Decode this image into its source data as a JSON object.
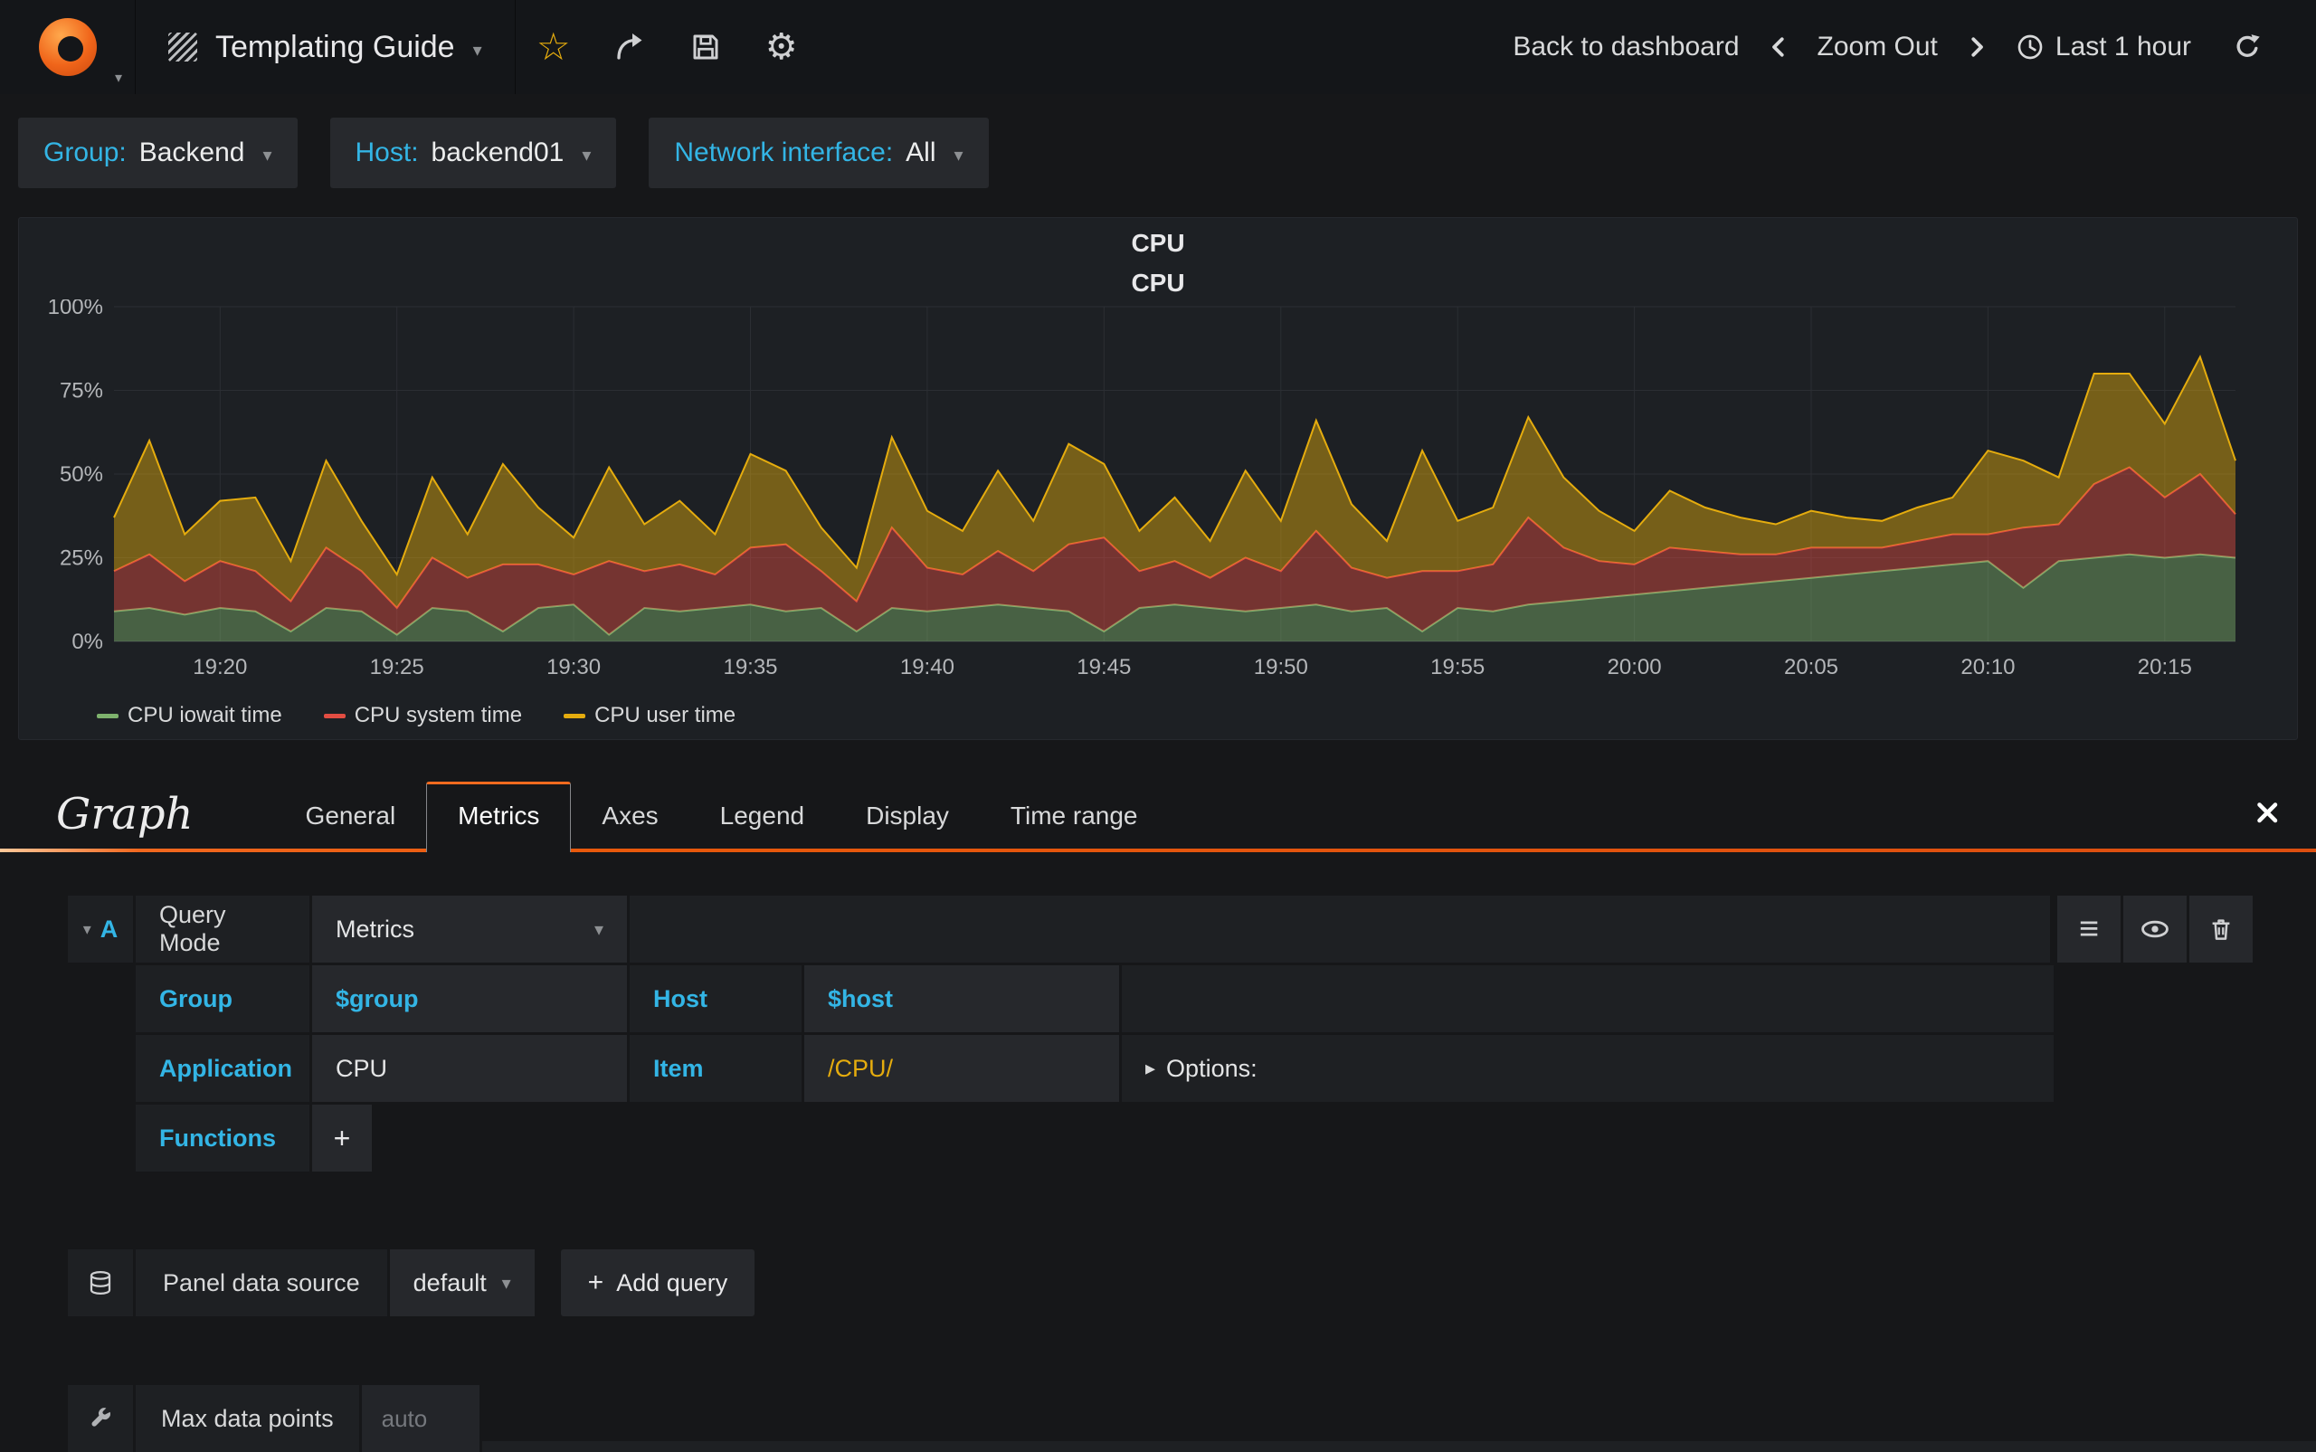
{
  "navbar": {
    "dashboard_title": "Templating Guide",
    "back_to_dashboard": "Back to dashboard",
    "zoom_out": "Zoom Out",
    "time_range": "Last 1 hour"
  },
  "icons": {
    "caret_down": "▾",
    "caret_right": "▸",
    "star": "☆",
    "gear": "⚙",
    "menu": "≡",
    "plus": "+"
  },
  "template_vars": [
    {
      "label": "Group:",
      "value": "Backend"
    },
    {
      "label": "Host:",
      "value": "backend01"
    },
    {
      "label": "Network interface:",
      "value": "All"
    }
  ],
  "panel": {
    "title": "CPU"
  },
  "chart_data": {
    "type": "area",
    "stacked": true,
    "title": "CPU",
    "xlabel": "",
    "ylabel": "",
    "ylim": [
      0,
      100
    ],
    "yticks": [
      "0%",
      "25%",
      "50%",
      "75%",
      "100%"
    ],
    "x_start": "19:17",
    "x_end": "20:17",
    "xticks": [
      "19:20",
      "19:25",
      "19:30",
      "19:35",
      "19:40",
      "19:45",
      "19:50",
      "19:55",
      "20:00",
      "20:05",
      "20:10",
      "20:15"
    ],
    "grid": true,
    "legend_position": "bottom",
    "series": [
      {
        "name": "CPU iowait time",
        "color": "#7eb26d",
        "values": [
          9,
          10,
          8,
          10,
          9,
          3,
          10,
          9,
          2,
          10,
          9,
          3,
          10,
          11,
          2,
          10,
          9,
          10,
          11,
          9,
          10,
          3,
          10,
          9,
          10,
          11,
          10,
          9,
          3,
          10,
          11,
          10,
          9,
          10,
          11,
          9,
          10,
          3,
          10,
          9,
          11,
          12,
          13,
          14,
          15,
          16,
          17,
          18,
          19,
          20,
          21,
          22,
          23,
          24,
          16,
          24,
          25,
          26,
          25,
          26,
          25
        ]
      },
      {
        "name": "CPU system time",
        "color": "#e24d42",
        "values": [
          12,
          16,
          10,
          14,
          12,
          9,
          18,
          12,
          8,
          15,
          10,
          20,
          13,
          9,
          22,
          11,
          14,
          10,
          17,
          20,
          11,
          9,
          24,
          13,
          10,
          16,
          11,
          20,
          28,
          11,
          13,
          9,
          16,
          11,
          22,
          13,
          9,
          18,
          11,
          14,
          26,
          16,
          11,
          9,
          13,
          11,
          9,
          8,
          9,
          8,
          7,
          8,
          9,
          8,
          18,
          11,
          22,
          26,
          18,
          24,
          13
        ]
      },
      {
        "name": "CPU user time",
        "color": "#e5ac0e",
        "values": [
          16,
          34,
          14,
          18,
          22,
          12,
          26,
          15,
          10,
          24,
          13,
          30,
          17,
          11,
          28,
          14,
          19,
          12,
          28,
          22,
          13,
          10,
          27,
          17,
          13,
          24,
          15,
          30,
          22,
          12,
          19,
          11,
          26,
          15,
          33,
          19,
          11,
          36,
          15,
          17,
          30,
          21,
          15,
          10,
          17,
          13,
          11,
          9,
          11,
          9,
          8,
          10,
          11,
          25,
          20,
          14,
          33,
          28,
          22,
          35,
          16
        ]
      }
    ]
  },
  "editor": {
    "panel_type": "Graph",
    "tabs": [
      "General",
      "Metrics",
      "Axes",
      "Legend",
      "Display",
      "Time range"
    ],
    "active_tab": "Metrics",
    "query": {
      "letter": "A",
      "query_mode_label": "Query Mode",
      "query_mode_value": "Metrics",
      "group_label": "Group",
      "group_value": "$group",
      "host_label": "Host",
      "host_value": "$host",
      "application_label": "Application",
      "application_value": "CPU",
      "item_label": "Item",
      "item_value": "/CPU/",
      "options_label": "Options:",
      "functions_label": "Functions"
    },
    "datasource": {
      "label": "Panel data source",
      "value": "default",
      "add_query": "Add query"
    },
    "max_data_points": {
      "label": "Max data points",
      "placeholder": "auto"
    }
  }
}
